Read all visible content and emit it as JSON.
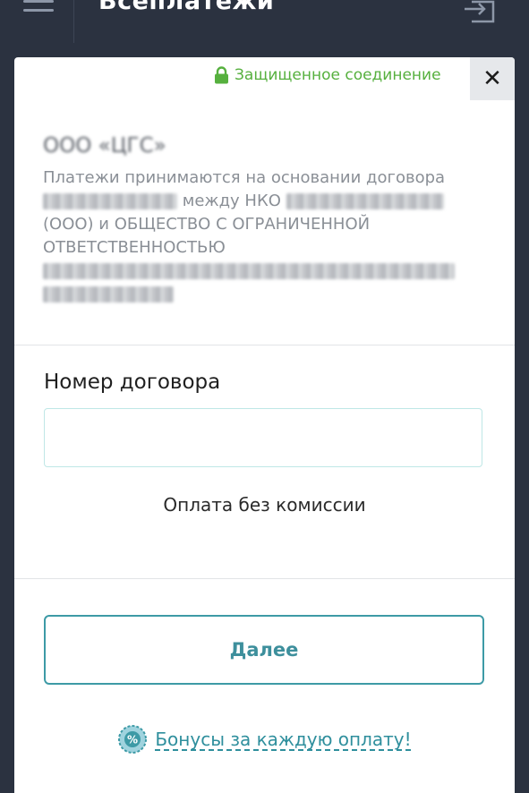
{
  "header": {
    "title": "Всеплатежи",
    "menu_icon": "hamburger-menu-icon",
    "login_icon": "login-icon"
  },
  "security": {
    "label": "Защищенное соединение",
    "icon": "lock-icon",
    "color": "#56b03e"
  },
  "organization": {
    "name": "ООО «ЦГС»",
    "desc_part1": "Платежи принимаются на основании договора",
    "desc_part2": "между НКО",
    "desc_part3": "(ООО) и ОБЩЕСТВО С ОГРАНИЧЕННОЙ ОТВЕТСТВЕННОСТЬЮ"
  },
  "form": {
    "contract_label": "Номер договора",
    "contract_value": "",
    "contract_placeholder": "",
    "fee_note": "Оплата без комиссии"
  },
  "actions": {
    "next_label": "Далее",
    "bonus_label": "Бонусы за каждую оплату!",
    "accent_color": "#3d9aa6"
  }
}
